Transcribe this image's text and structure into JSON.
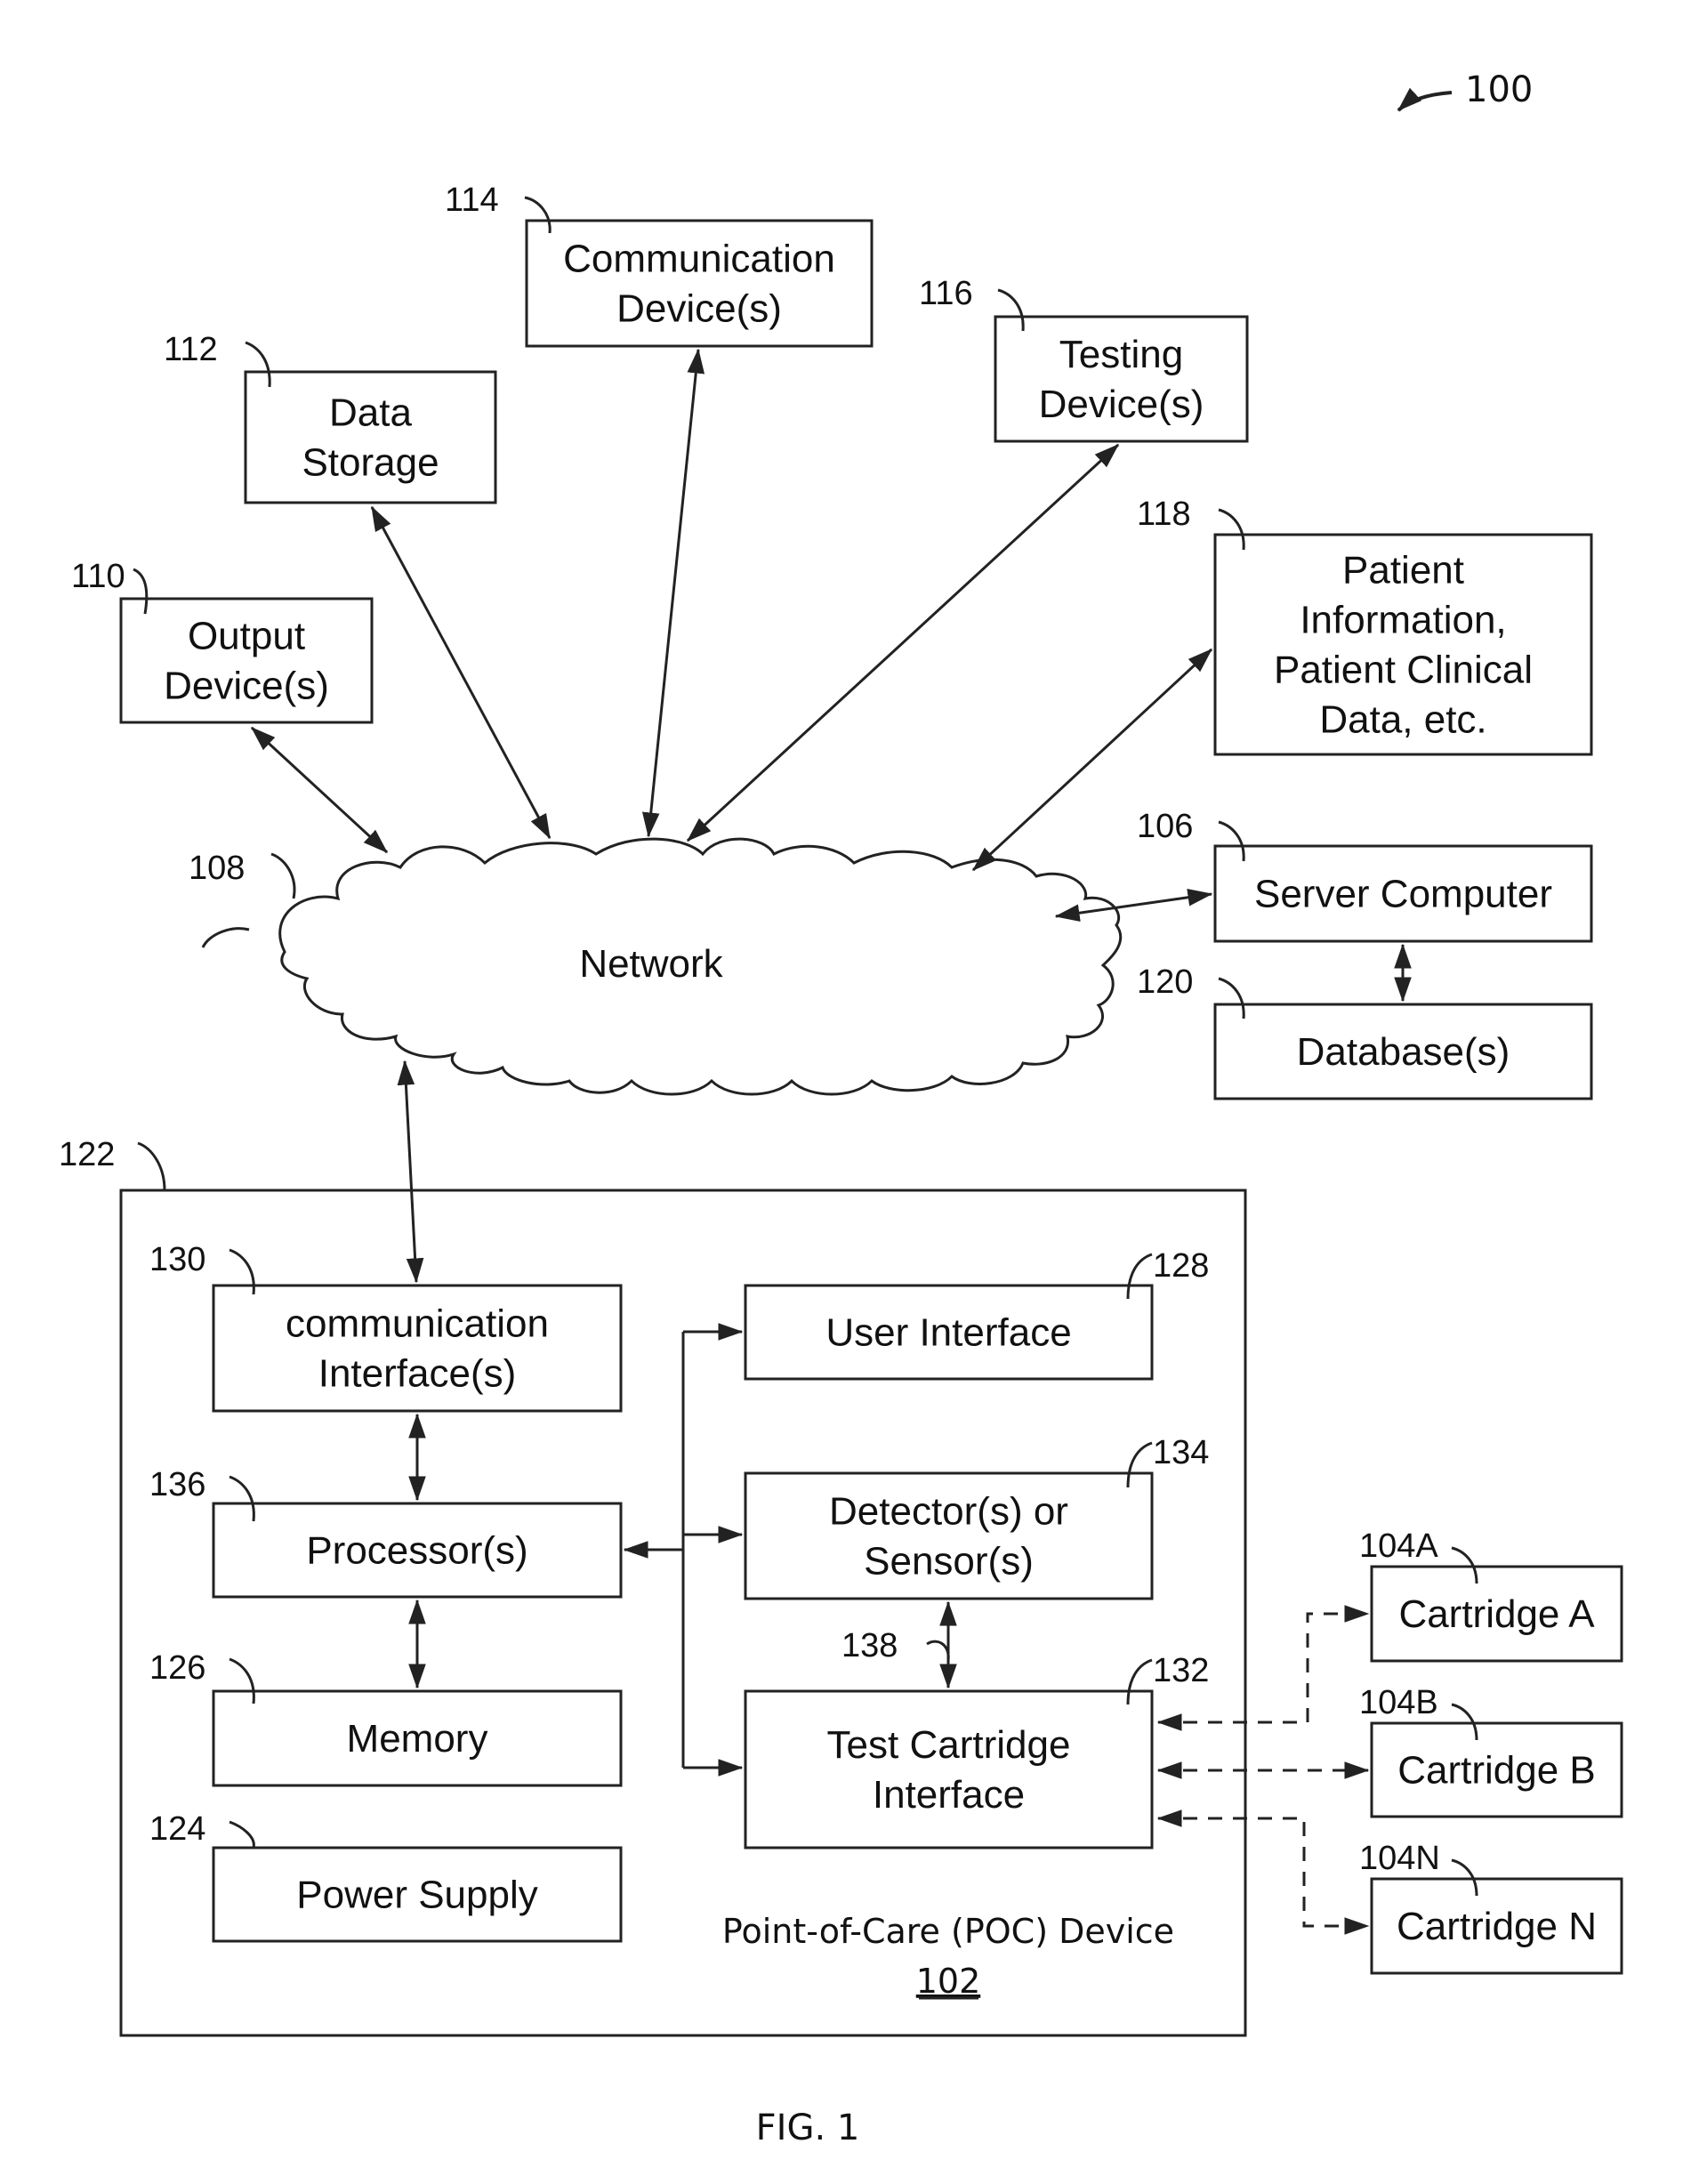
{
  "figure": {
    "ref": "100",
    "caption": "FIG. 1"
  },
  "network": {
    "label": "Network",
    "ref": "108"
  },
  "external_nodes": [
    {
      "id": "output",
      "ref": "110",
      "lines": [
        "Output",
        "Device(s)"
      ]
    },
    {
      "id": "data-storage",
      "ref": "112",
      "lines": [
        "Data",
        "Storage"
      ]
    },
    {
      "id": "communication",
      "ref": "114",
      "lines": [
        "Communication",
        "Device(s)"
      ]
    },
    {
      "id": "testing",
      "ref": "116",
      "lines": [
        "Testing",
        "Device(s)"
      ]
    },
    {
      "id": "patient-info",
      "ref": "118",
      "lines": [
        "Patient",
        "Information,",
        "Patient Clinical",
        "Data, etc."
      ]
    },
    {
      "id": "server",
      "ref": "106",
      "lines": [
        "Server Computer"
      ]
    },
    {
      "id": "database",
      "ref": "120",
      "lines": [
        "Database(s)"
      ]
    }
  ],
  "poc_device": {
    "ref": "122",
    "title": "Point-of-Care (POC) Device",
    "number": "102",
    "components": [
      {
        "id": "comm-interface",
        "ref": "130",
        "lines": [
          "communication",
          "Interface(s)"
        ]
      },
      {
        "id": "processor",
        "ref": "136",
        "lines": [
          "Processor(s)"
        ]
      },
      {
        "id": "memory",
        "ref": "126",
        "lines": [
          "Memory"
        ]
      },
      {
        "id": "power-supply",
        "ref": "124",
        "lines": [
          "Power Supply"
        ]
      },
      {
        "id": "user-interface",
        "ref": "128",
        "lines": [
          "User Interface"
        ]
      },
      {
        "id": "detector",
        "ref": "134",
        "lines": [
          "Detector(s) or",
          "Sensor(s)"
        ]
      },
      {
        "id": "test-cartridge-interface",
        "ref": "132",
        "lines": [
          "Test Cartridge",
          "Interface"
        ]
      }
    ],
    "link_ref": "138"
  },
  "cartridges": [
    {
      "id": "cartridge-a",
      "ref": "104A",
      "label": "Cartridge A"
    },
    {
      "id": "cartridge-b",
      "ref": "104B",
      "label": "Cartridge B"
    },
    {
      "id": "cartridge-n",
      "ref": "104N",
      "label": "Cartridge N"
    }
  ]
}
